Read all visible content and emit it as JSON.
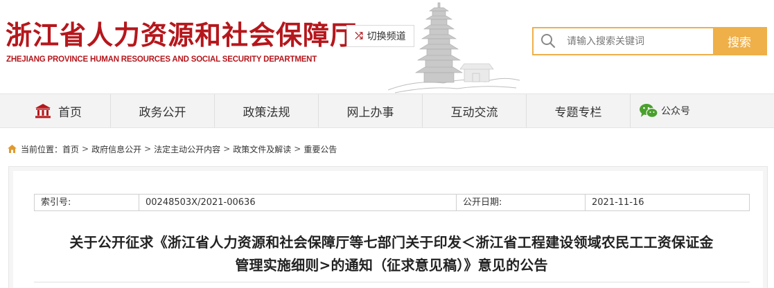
{
  "header": {
    "title_cn": "浙江省人力资源和社会保障厅",
    "title_en": "ZHEJIANG PROVINCE HUMAN RESOURCES AND SOCIAL SECURITY DEPARTMENT",
    "switch_label": "切换频道",
    "brand_color": "#b5171c"
  },
  "search": {
    "placeholder": "请输入搜索关键词",
    "button_label": "搜索",
    "accent_color": "#efb049"
  },
  "nav": {
    "items": [
      {
        "label": "首页",
        "icon": "home-icon"
      },
      {
        "label": "政务公开"
      },
      {
        "label": "政策法规"
      },
      {
        "label": "网上办事"
      },
      {
        "label": "互动交流"
      },
      {
        "label": "专题专栏"
      },
      {
        "label": "公众号",
        "icon": "wechat-icon"
      }
    ]
  },
  "breadcrumb": {
    "prefix": "当前位置：",
    "items": [
      "首页",
      "政府信息公开",
      "法定主动公开内容",
      "政策文件及解读",
      "重要公告"
    ],
    "separator": ">"
  },
  "document": {
    "meta": {
      "index_label": "索引号:",
      "index_value": "00248503X/2021-00636",
      "date_label": "公开日期:",
      "date_value": "2021-11-16"
    },
    "title_line1": "关于公开征求《浙江省人力资源和社会保障厅等七部门关于印发＜浙江省工程建设领域农民工工资保证金",
    "title_line2": "管理实施细则>的通知（征求意见稿）》意见的公告"
  }
}
